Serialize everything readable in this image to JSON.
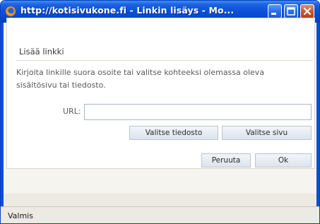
{
  "window": {
    "title": "http://kotisivukone.fi - Linkin lisäys - Mo...",
    "icon": "firefox-icon",
    "controls": {
      "minimize_icon": "minimize-icon",
      "maximize_icon": "maximize-icon",
      "close_icon": "close-icon"
    }
  },
  "dialog": {
    "title": "Lisää linkki",
    "instructions": "Kirjoita linkille suora osoite tai valitse kohteeksi olemassa oleva sisältösivu tai tiedosto.",
    "url": {
      "label": "URL:",
      "value": "",
      "placeholder": ""
    },
    "buttons": {
      "choose_file": "Valitse tiedosto",
      "choose_page": "Valitse sivu",
      "cancel": "Peruuta",
      "ok": "Ok"
    }
  },
  "statusbar": {
    "text": "Valmis"
  },
  "colors": {
    "titlebar": "#0a4fd6",
    "close_button": "#d8532d",
    "window_bg": "#eceae3",
    "button_border": "#b8c4d4"
  }
}
